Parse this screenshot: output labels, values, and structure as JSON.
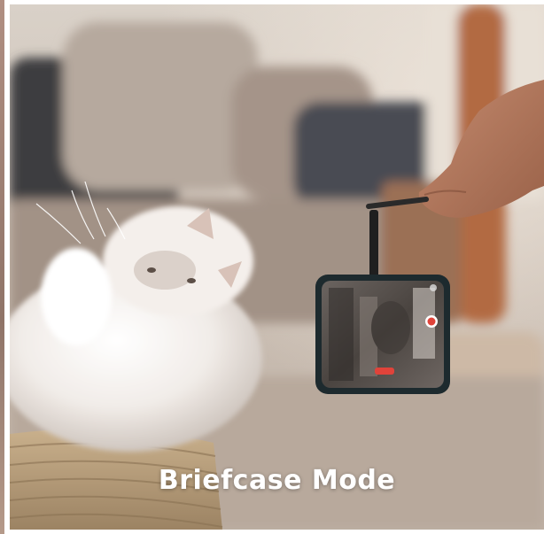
{
  "image": {
    "caption": "Briefcase Mode",
    "description_icons": [
      "cat-figure",
      "hand-figure",
      "phone-figure",
      "basket-figure",
      "record-icon"
    ]
  }
}
